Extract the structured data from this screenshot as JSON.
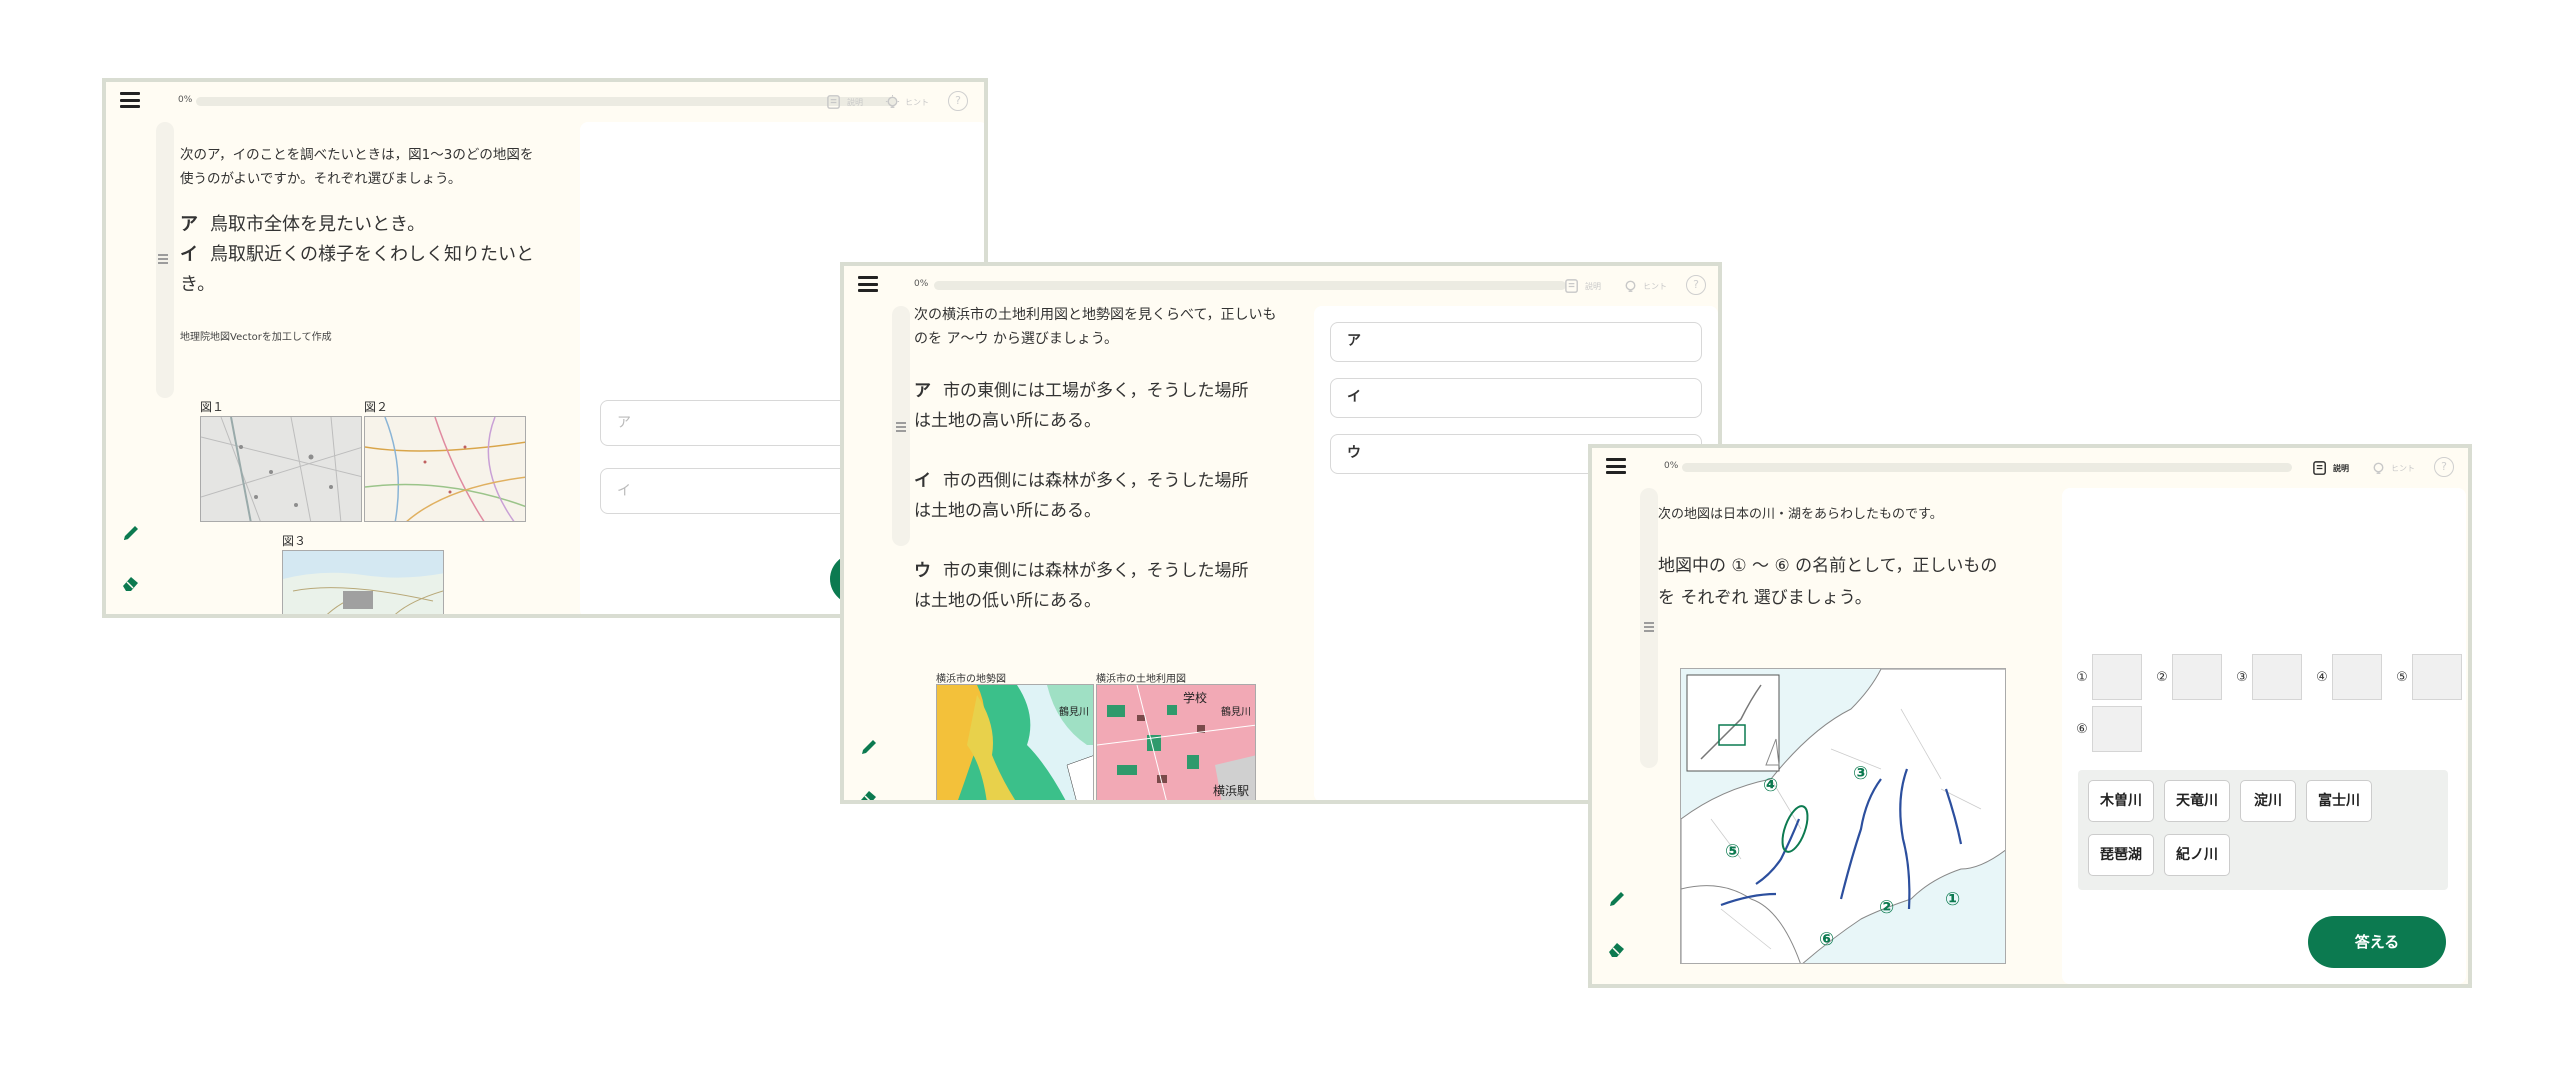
{
  "colors": {
    "accent": "#0c7a50",
    "frame_border": "#d9ddd2",
    "background": "#fffcf3",
    "panel": "#ffffff"
  },
  "window_a": {
    "progress_label": "0%",
    "progress": 0,
    "explain_label": "説明",
    "hint_label": "ヒント",
    "help_label": "?",
    "question_line1": "次のア，イのことを調べたいときは，図1〜3のどの地図を",
    "question_line2": "使うのがよいですか。それぞれ選びましょう。",
    "statements": [
      {
        "mark": "ア",
        "text": "鳥取市全体を見たいとき。"
      },
      {
        "mark": "イ",
        "text": "鳥取駅近くの様子をくわしく知りたいと"
      }
    ],
    "statement_tail": "き。",
    "source_note": "地理院地図Vectorを加工して作成",
    "map_labels": [
      "図１",
      "図２",
      "図３"
    ],
    "answer_placeholders": [
      "ア",
      "イ"
    ]
  },
  "window_b": {
    "progress_label": "0%",
    "progress": 0,
    "explain_label": "説明",
    "hint_label": "ヒント",
    "help_label": "?",
    "question_line1": "次の横浜市の土地利用図と地勢図を見くらべて，正しいも",
    "question_line2": "のを ア〜ウ から選びましょう。",
    "statements": [
      {
        "mark": "ア",
        "line1": "市の東側には工場が多く，そうした場所",
        "line2": "は土地の高い所にある。"
      },
      {
        "mark": "イ",
        "line1": "市の西側には森林が多く，そうした場所",
        "line2": "は土地の高い所にある。"
      },
      {
        "mark": "ウ",
        "line1": "市の東側には森林が多く，そうした場所",
        "line2": "は土地の低い所にある。"
      }
    ],
    "map_titles": [
      "横浜市の地勢図",
      "横浜市の土地利用図"
    ],
    "map_texts": [
      "鶴見川",
      "学校",
      "鶴見川",
      "横浜駅"
    ],
    "options": [
      "ア",
      "イ",
      "ウ"
    ]
  },
  "window_c": {
    "progress_label": "0%",
    "progress": 0,
    "explain_label": "説明",
    "hint_label": "ヒント",
    "help_label": "?",
    "intro": "次の地図は日本の川・湖をあらわしたものです。",
    "question_line1": "地図中の ① 〜 ⑥ の名前として，正しいもの",
    "question_line2": "を それぞれ 選びましょう。",
    "map_markers": [
      "①",
      "②",
      "③",
      "④",
      "⑤",
      "⑥"
    ],
    "slot_numbers": [
      "①",
      "②",
      "③",
      "④",
      "⑤",
      "⑥"
    ],
    "choices": [
      "木曽川",
      "天竜川",
      "淀川",
      "富士川",
      "琵琶湖",
      "紀ノ川"
    ],
    "answer_label": "答える"
  }
}
